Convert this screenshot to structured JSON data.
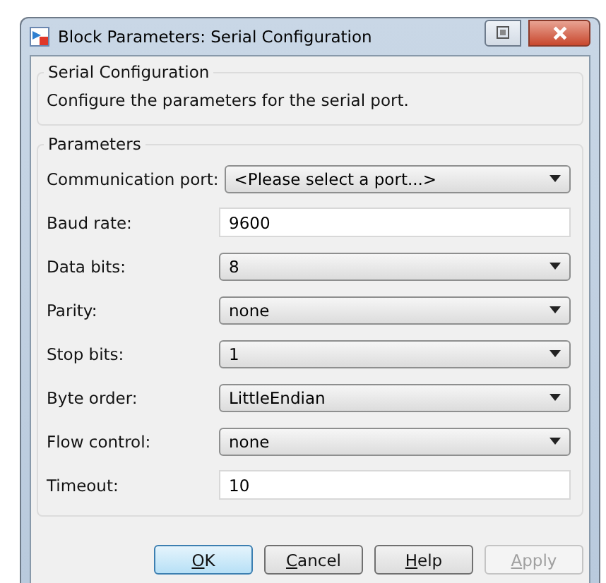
{
  "window": {
    "title": "Block Parameters: Serial Configuration"
  },
  "description_group": {
    "title": "Serial Configuration",
    "text": "Configure the parameters for the serial port."
  },
  "parameters_group": {
    "title": "Parameters",
    "rows": [
      {
        "kind": "dropdown",
        "label": "Communication port:",
        "value": "<Please select a port...>"
      },
      {
        "kind": "text",
        "label": "Baud rate:",
        "value": "9600"
      },
      {
        "kind": "dropdown",
        "label": "Data bits:",
        "value": "8"
      },
      {
        "kind": "dropdown",
        "label": "Parity:",
        "value": "none"
      },
      {
        "kind": "dropdown",
        "label": "Stop bits:",
        "value": "1"
      },
      {
        "kind": "dropdown",
        "label": "Byte order:",
        "value": "LittleEndian"
      },
      {
        "kind": "dropdown",
        "label": "Flow control:",
        "value": "none"
      },
      {
        "kind": "text",
        "label": "Timeout:",
        "value": "10"
      }
    ]
  },
  "buttons": [
    {
      "mnemonic": "O",
      "rest": "K",
      "default": true,
      "disabled": false
    },
    {
      "mnemonic": "C",
      "rest": "ancel",
      "default": false,
      "disabled": false
    },
    {
      "mnemonic": "H",
      "rest": "elp",
      "default": false,
      "disabled": false
    },
    {
      "mnemonic": "A",
      "rest": "pply",
      "default": false,
      "disabled": true
    }
  ]
}
